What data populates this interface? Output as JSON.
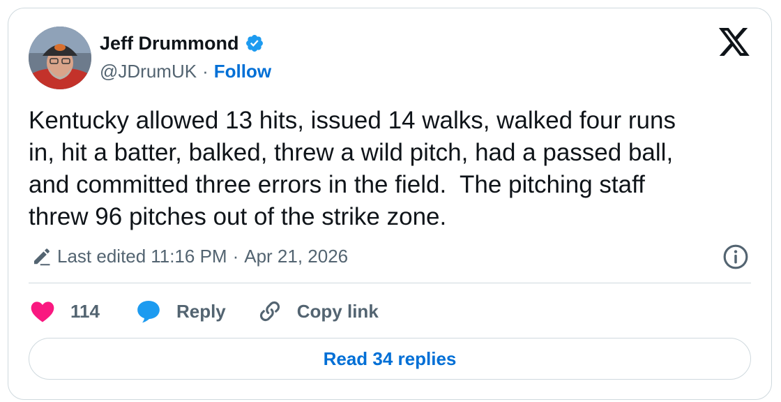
{
  "colors": {
    "link": "#006fd6",
    "verified": "#1d9bf0",
    "like": "#f91880",
    "muted": "#536471",
    "border": "#cfd9de",
    "text": "#0f1419"
  },
  "author": {
    "name": "Jeff Drummond",
    "handle": "@JDrumUK",
    "separator": "·",
    "follow_label": "Follow",
    "verified_icon": "verified-badge-icon",
    "avatar": "profile-photo"
  },
  "brand": {
    "icon": "x-logo-icon"
  },
  "tweet": {
    "text": "Kentucky allowed 13 hits, issued 14 walks, walked four runs\nin, hit a batter, balked, threw a wild pitch, had a passed ball,\nand committed three errors in the field.  The pitching staff\nthrew 96 pitches out of the strike zone."
  },
  "meta": {
    "edited_label": "Last edited",
    "time": "11:16 PM",
    "separator": "·",
    "date": "Apr 21, 2026",
    "edit_icon": "pencil-icon",
    "info_icon": "info-icon"
  },
  "actions": {
    "like_count": "114",
    "reply_label": "Reply",
    "copy_label": "Copy link"
  },
  "footer": {
    "read_replies_label": "Read 34 replies"
  }
}
